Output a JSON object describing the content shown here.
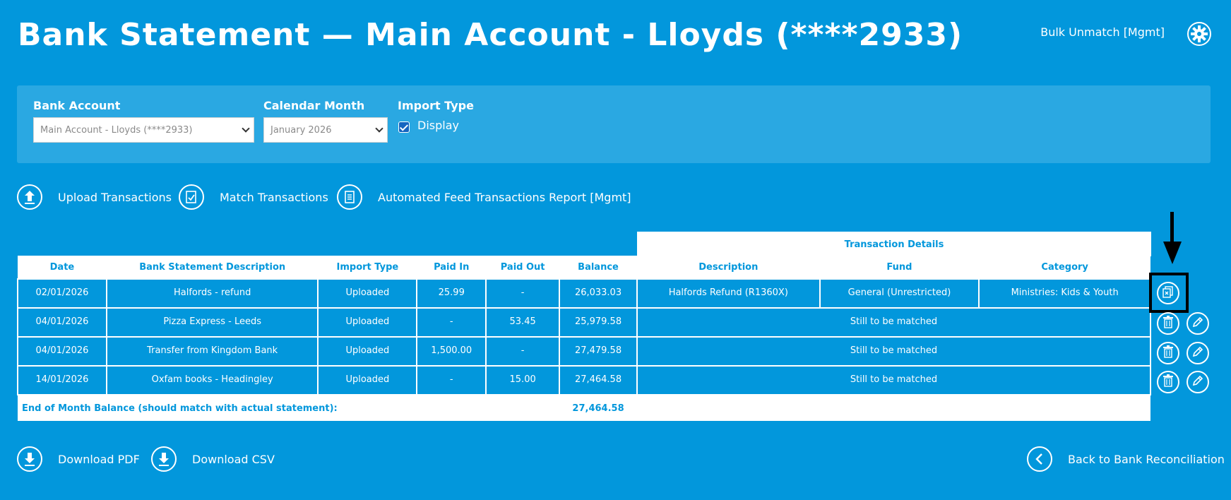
{
  "header": {
    "title": "Bank Statement — Main Account - Lloyds (****2933)",
    "bulk_unmatch": "Bulk Unmatch [Mgmt]",
    "settings_icon": "gear-icon"
  },
  "filters": {
    "bank_account_label": "Bank Account",
    "bank_account_value": "Main Account - Lloyds (****2933)",
    "calendar_month_label": "Calendar Month",
    "calendar_month_value": "January 2026",
    "import_type_label": "Import Type",
    "import_type_option": "Display",
    "import_type_checked": true
  },
  "actions": {
    "upload": "Upload Transactions",
    "match": "Match Transactions",
    "report": "Automated Feed Transactions Report [Mgmt]"
  },
  "table": {
    "group_header": "Transaction Details",
    "columns": [
      "Date",
      "Bank Statement Description",
      "Import Type",
      "Paid In",
      "Paid Out",
      "Balance",
      "Description",
      "Fund",
      "Category"
    ],
    "rows": [
      {
        "date": "02/01/2026",
        "desc": "Halfords - refund",
        "import_type": "Uploaded",
        "paid_in": "25.99",
        "paid_out": "-",
        "balance": "26,033.03",
        "tx_desc": "Halfords Refund (R1360X)",
        "fund": "General (Unrestricted)",
        "category": "Ministries: Kids & Youth"
      },
      {
        "date": "04/01/2026",
        "desc": "Pizza Express - Leeds",
        "import_type": "Uploaded",
        "paid_in": "-",
        "paid_out": "53.45",
        "balance": "25,979.58",
        "status": "Still to be matched"
      },
      {
        "date": "04/01/2026",
        "desc": "Transfer from Kingdom Bank",
        "import_type": "Uploaded",
        "paid_in": "1,500.00",
        "paid_out": "-",
        "balance": "27,479.58",
        "status": "Still to be matched"
      },
      {
        "date": "14/01/2026",
        "desc": "Oxfam books - Headingley",
        "import_type": "Uploaded",
        "paid_in": "-",
        "paid_out": "15.00",
        "balance": "27,464.58",
        "status": "Still to be matched"
      }
    ],
    "footer_label": "End of Month Balance (should match with actual statement):",
    "footer_balance": "27,464.58"
  },
  "bottom_actions": {
    "download_pdf": "Download PDF",
    "download_csv": "Download CSV",
    "back": "Back to Bank Reconciliation"
  },
  "colors": {
    "background": "#0297dc",
    "panel": "#2aa8e2",
    "highlight": "#000000"
  }
}
